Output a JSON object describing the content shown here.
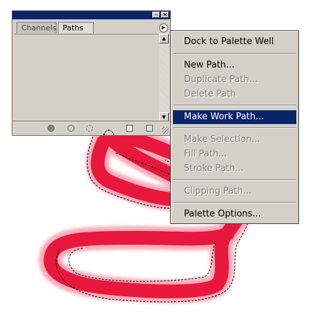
{
  "palette": {
    "tabs": [
      {
        "label": "Channels",
        "active": false
      },
      {
        "label": "Paths",
        "active": true
      }
    ],
    "title_buttons": {
      "minimize": "‒",
      "close": "✕"
    },
    "menu_arrow_glyph": "▶",
    "bottom_icons": [
      "fill-path-icon",
      "stroke-path-icon",
      "load-selection-icon",
      "make-work-path-icon",
      "new-path-icon",
      "delete-path-icon"
    ],
    "title_bar_color": "#0a246a"
  },
  "menu": {
    "items": [
      {
        "label": "Dock to Palette Well",
        "enabled": true
      },
      {
        "label": "New Path...",
        "enabled": true
      },
      {
        "label": "Duplicate Path...",
        "enabled": false
      },
      {
        "label": "Delete Path",
        "enabled": false
      },
      {
        "label": "Make Work Path...",
        "enabled": true,
        "highlighted": true
      },
      {
        "label": "Make Selection...",
        "enabled": false
      },
      {
        "label": "Fill Path...",
        "enabled": false
      },
      {
        "label": "Stroke Path...",
        "enabled": false
      },
      {
        "label": "Clipping Path...",
        "enabled": false
      },
      {
        "label": "Palette Options...",
        "enabled": true
      }
    ],
    "highlight_color": "#0a246a"
  },
  "canvas": {
    "stroke_color": "#e8183c",
    "annotation_color": "#e0303a"
  }
}
